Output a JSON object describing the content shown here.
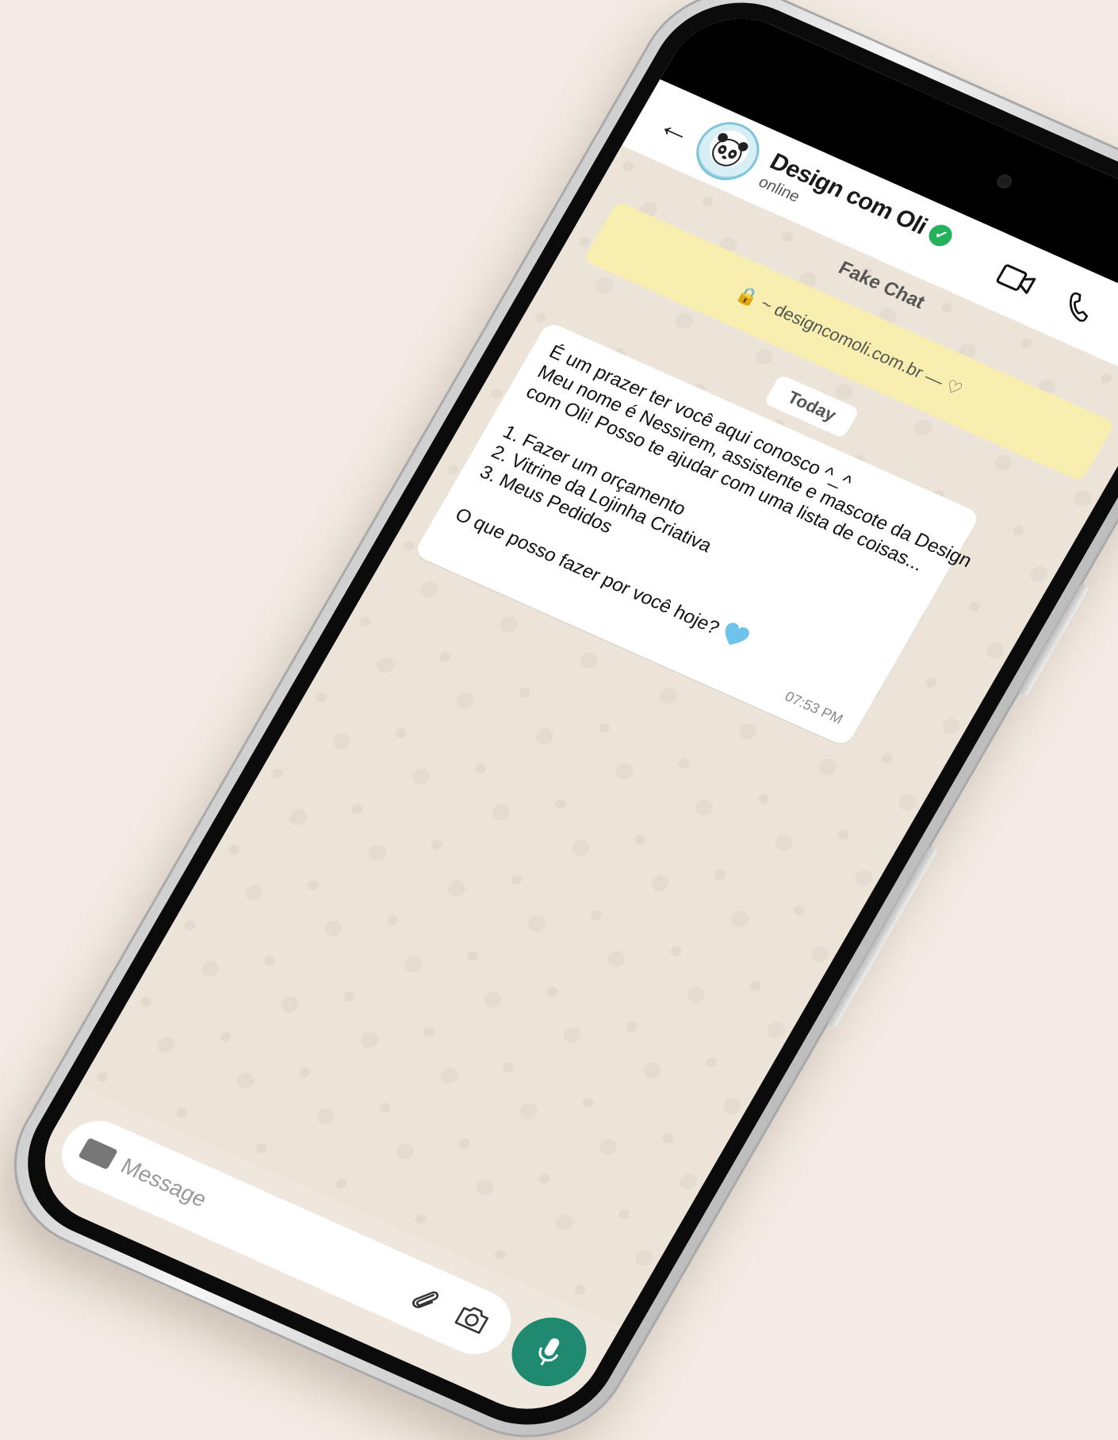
{
  "header": {
    "contact_name": "Design com Oli",
    "status": "online"
  },
  "chat": {
    "title": "Fake Chat",
    "banner": "🔒 ~ designcomoli.com.br — ♡",
    "day_label": "Today",
    "message": {
      "lines": [
        "É um prazer ter você aqui conosco ^_^",
        "Meu nome é Nessirem, assistente e mascote da Design",
        "com Oli! Posso te ajudar com uma lista de coisas...",
        "",
        "1. Fazer um orçamento",
        "2. Vitrine da Lojinha Criativa",
        "3. Meus Pedidos",
        "",
        "O que posso fazer por você hoje?"
      ],
      "time": "07:53 PM"
    }
  },
  "input": {
    "placeholder": "Message"
  },
  "colors": {
    "background": "#f3ebe3",
    "verified": "#25b05b",
    "banner": "#f7eeb0",
    "mic": "#1f8a6f",
    "heart": "#6ec3ea"
  },
  "icons": {
    "back": "back-arrow-icon",
    "video": "video-call-icon",
    "phone": "phone-call-icon",
    "menu": "more-vert-icon",
    "verified": "verified-badge-icon",
    "keyboard": "keyboard-icon",
    "attach": "paperclip-icon",
    "camera": "camera-icon",
    "mic": "microphone-icon",
    "heart": "blue-heart-icon"
  }
}
